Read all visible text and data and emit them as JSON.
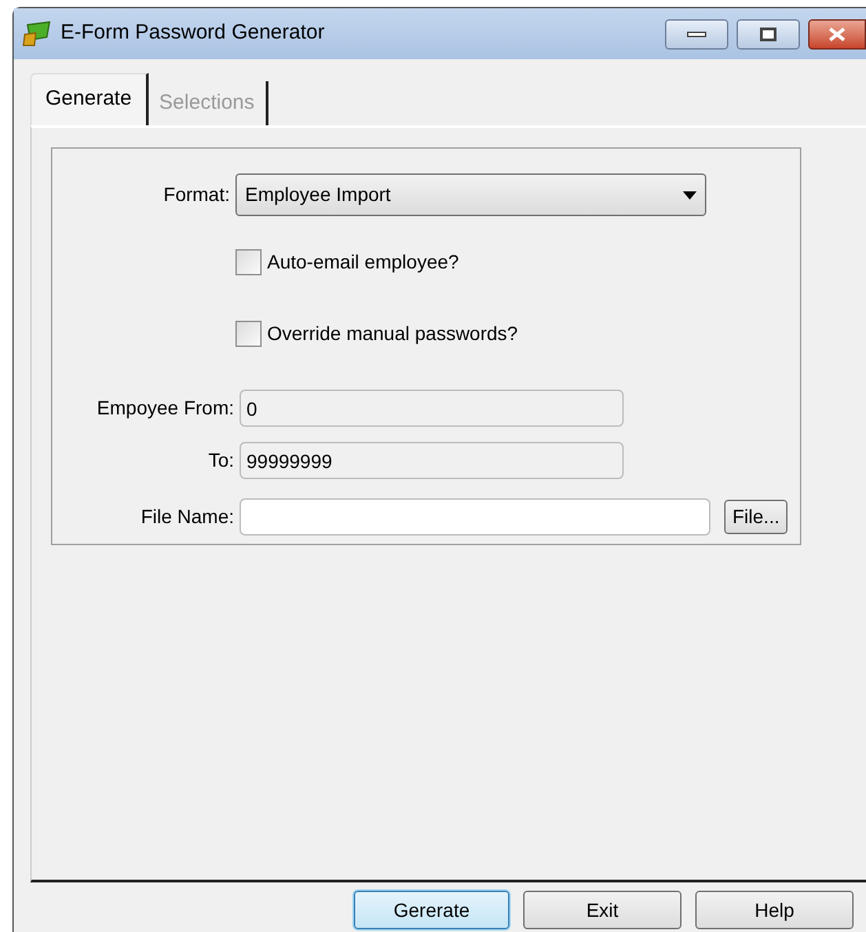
{
  "window": {
    "title": "E-Form Password Generator"
  },
  "tabs": [
    {
      "label": "Generate",
      "selected": true
    },
    {
      "label": "Selections",
      "selected": false
    }
  ],
  "format": {
    "label": "Format:",
    "value": "Employee Import"
  },
  "checkboxes": [
    {
      "label": "Auto-email employee?",
      "checked": false
    },
    {
      "label": "Override manual passwords?",
      "checked": false
    }
  ],
  "fields": [
    {
      "label": "Empoyee From:",
      "value": "0",
      "kind": "range"
    },
    {
      "label": "To:",
      "value": "99999999",
      "kind": "range"
    },
    {
      "label": "File Name:",
      "kind": "file",
      "button": "File..."
    }
  ],
  "buttons": [
    {
      "label": "Gererate",
      "selected": true
    },
    {
      "label": "Exit",
      "selected": false
    },
    {
      "label": "Help",
      "selected": false
    }
  ]
}
